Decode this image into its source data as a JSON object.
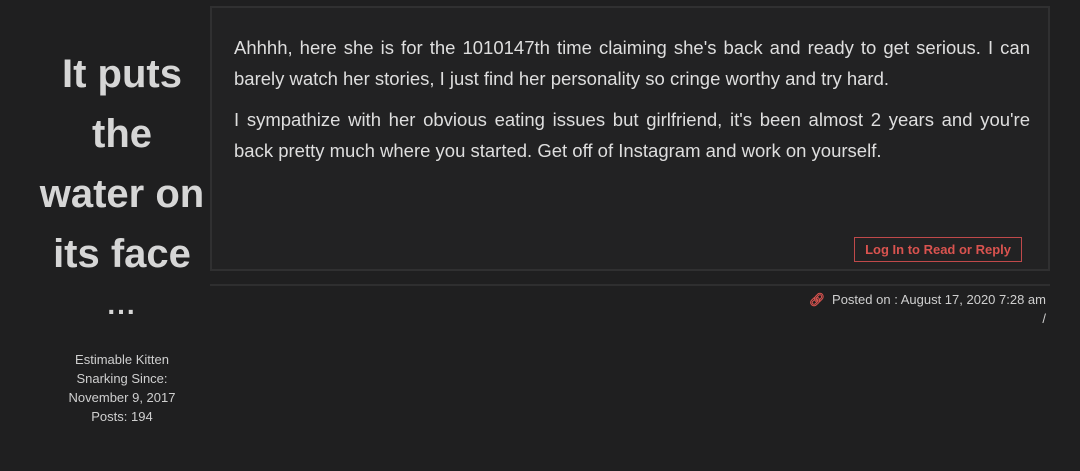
{
  "author": {
    "name_lines": [
      "It puts",
      "the",
      "water on",
      "its face"
    ],
    "ellipsis": "...",
    "title": "Estimable Kitten",
    "since_label": "Snarking Since:",
    "since_date": "November 9, 2017",
    "posts_label": "Posts:",
    "posts_count": "194"
  },
  "post": {
    "paragraphs": [
      "Ahhhh, here she is for the 1010147th time claiming she's back and ready to get serious. I can barely watch her stories, I just find her personality so cringe worthy and try hard.",
      "I sympathize with her obvious eating issues but girlfriend, it's been almost 2 years and you're back pretty much where you started. Get off of Instagram and work on yourself."
    ],
    "login_button": "Log In to Read or Reply"
  },
  "footer": {
    "posted_label": "Posted on :",
    "posted_date": "August 17, 2020 7:28 am",
    "separator": "/",
    "link_icon_name": "link-icon",
    "accent_color": "#d9534f"
  }
}
